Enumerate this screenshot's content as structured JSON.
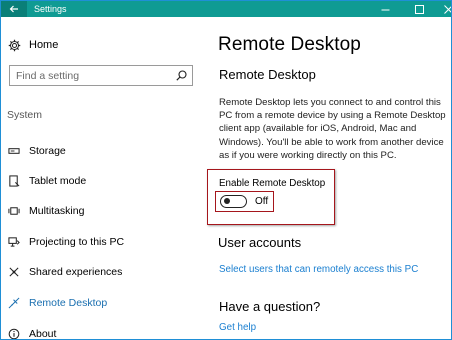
{
  "window": {
    "title": "Settings",
    "accent_color": "#0f9b93",
    "controls": [
      "minimize-icon",
      "maximize-icon",
      "close-icon"
    ]
  },
  "sidebar": {
    "home_label": "Home",
    "search_placeholder": "Find a setting",
    "section_label": "System",
    "items": [
      {
        "label": "Storage",
        "icon": "storage-icon"
      },
      {
        "label": "Tablet mode",
        "icon": "tablet-mode-icon"
      },
      {
        "label": "Multitasking",
        "icon": "multitasking-icon"
      },
      {
        "label": "Projecting to this PC",
        "icon": "projecting-icon"
      },
      {
        "label": "Shared experiences",
        "icon": "shared-experiences-icon"
      },
      {
        "label": "Remote Desktop",
        "icon": "remote-desktop-icon",
        "active": true
      },
      {
        "label": "About",
        "icon": "about-icon"
      }
    ]
  },
  "main": {
    "page_title": "Remote Desktop",
    "section_title": "Remote Desktop",
    "description": "Remote Desktop lets you connect to and control this PC from a remote device by using a Remote Desktop client app (available for iOS, Android, Mac and Windows). You'll be able to work from another device as if you were working directly on this PC.",
    "enable_label": "Enable Remote Desktop",
    "toggle_state": "Off",
    "toggle_on": false,
    "user_accounts_title": "User accounts",
    "user_accounts_link": "Select users that can remotely access this PC",
    "question_title": "Have a question?",
    "help_link": "Get help",
    "link_color": "#1a7fd0",
    "highlight_color": "#a5161c"
  }
}
